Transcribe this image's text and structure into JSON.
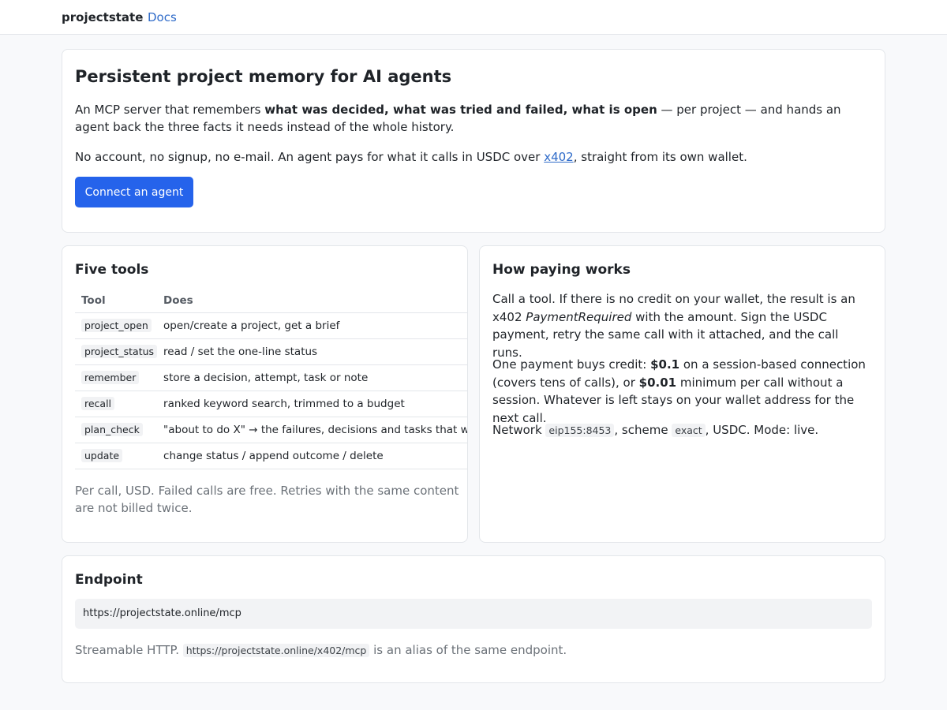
{
  "nav": {
    "brand": "projectstate",
    "docs_label": "Docs"
  },
  "hero": {
    "title": "Persistent project memory for AI agents",
    "p1_prefix": "An MCP server that remembers ",
    "p1_bold": "what was decided, what was tried and failed, what is open",
    "p1_suffix": " — per project — and hands an agent back the three facts it needs instead of the whole history.",
    "p2_prefix": "No account, no signup, no e-mail. An agent pays for what it calls in USDC over ",
    "p2_link": "x402",
    "p2_suffix": ", straight from its own wallet.",
    "cta_label": "Connect an agent"
  },
  "tools": {
    "title": "Five tools",
    "col_tool": "Tool",
    "col_does": "Does",
    "rows": [
      {
        "tool": "project_open",
        "does": "open/create a project, get a brief"
      },
      {
        "tool": "project_status",
        "does": "read / set the one-line status"
      },
      {
        "tool": "remember",
        "does": "store a decision, attempt, task or note"
      },
      {
        "tool": "recall",
        "does": "ranked keyword search, trimmed to a budget"
      },
      {
        "tool": "plan_check",
        "does": "\"about to do X\" → the failures, decisions and tasks that would"
      },
      {
        "tool": "update",
        "does": "change status / append outcome / delete"
      }
    ],
    "note": "Per call, USD. Failed calls are free. Retries with the same content are not billed twice."
  },
  "paying": {
    "title": "How paying works",
    "p1_a": "Call a tool. If there is no credit on your wallet, the result is an x402 ",
    "p1_italic": "PaymentRequired",
    "p1_b": " with the amount. Sign the USDC payment, retry the same call with it attached, and the call runs.",
    "p2_a": "One payment buys credit: ",
    "p2_bold1": "$0.1",
    "p2_b": " on a session-based connection (covers tens of calls), or ",
    "p2_bold2": "$0.01",
    "p2_c": " minimum per call without a session. Whatever is left stays on your wallet address for the next call.",
    "net_label": "Network ",
    "net_value": "eip155:8453",
    "scheme_label": ", scheme ",
    "scheme_value": "exact",
    "net_suffix": ", USDC. Mode: live."
  },
  "endpoint": {
    "title": "Endpoint",
    "url": "https://projectstate.online/mcp",
    "note_prefix": "Streamable HTTP. ",
    "alias_url": "https://projectstate.online/x402/mcp",
    "note_suffix": " is an alias of the same endpoint."
  }
}
